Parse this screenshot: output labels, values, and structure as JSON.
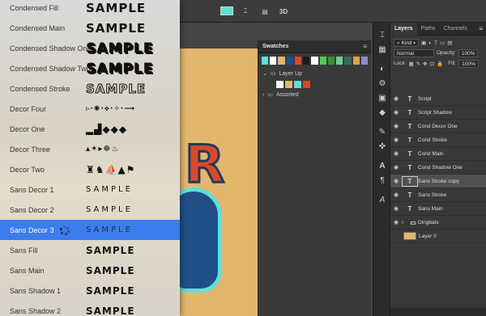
{
  "topbar": {
    "three_d_label": "3D",
    "text_icon_glyph": "⌶",
    "swatch_color": "#5fe0d6"
  },
  "swatches_panel": {
    "title": "Swatches",
    "menu_glyph": "≡",
    "collapse_glyph": "»",
    "recent_colors": [
      "#5fe0d6",
      "#ffffff",
      "#e3b66e",
      "#1f4f86",
      "#d94a2c",
      "#1a1a1a",
      "#ffffff",
      "#55c85a",
      "#3a8a3a",
      "#6fd08c",
      "#3a6a5a",
      "#d4a84a",
      "#8d8dc8"
    ],
    "folders": [
      {
        "label": "Layer Up",
        "expanded": true,
        "colors": [
          "#ffffff",
          "#e3b66e",
          "#5fe0d6",
          "#d94a2c"
        ]
      },
      {
        "label": "Assorted",
        "expanded": false,
        "colors": []
      }
    ]
  },
  "layers_panel": {
    "tabs": [
      "Layers",
      "Paths",
      "Channels"
    ],
    "active_tab": "Layers",
    "filter_label": "Kind",
    "blend_mode": "Normal",
    "opacity_label": "Opacity:",
    "opacity_value": "100%",
    "lock_label": "Lock:",
    "fill_label": "Fill:",
    "fill_value": "100%",
    "layers": [
      {
        "name": "Script",
        "kind": "text",
        "selected": false
      },
      {
        "name": "Script Shadow",
        "kind": "text",
        "selected": false
      },
      {
        "name": "Cond Decor One",
        "kind": "text",
        "selected": false
      },
      {
        "name": "Cond Stroke",
        "kind": "text",
        "selected": false
      },
      {
        "name": "Cond Main",
        "kind": "text",
        "selected": false
      },
      {
        "name": "Cond Shadow One",
        "kind": "text",
        "selected": false
      },
      {
        "name": "Sans Stroke copy",
        "kind": "text",
        "selected": true
      },
      {
        "name": "Sans Stroke",
        "kind": "text",
        "selected": false
      },
      {
        "name": "Sans Main",
        "kind": "text",
        "selected": false
      },
      {
        "name": "Dingbats",
        "kind": "group",
        "selected": false
      },
      {
        "name": "Layer 0",
        "kind": "fill",
        "selected": false
      }
    ]
  },
  "font_menu": {
    "sample_text": "SAMPLE",
    "items": [
      {
        "name": "Condensed Fill",
        "sample": "SAMPLE",
        "selected": false
      },
      {
        "name": "Condensed Main",
        "sample": "SAMPLE",
        "selected": false
      },
      {
        "name": "Condensed Shadow One",
        "sample": "SAMPLE",
        "selected": false
      },
      {
        "name": "Condensed Shadow Two",
        "sample": "SAMPLE",
        "selected": false
      },
      {
        "name": "Condensed Stroke",
        "sample": "SAMPLE",
        "selected": false
      },
      {
        "name": "Decor Four",
        "sample": "▹·✺·⟡·✧·⟶",
        "selected": false
      },
      {
        "name": "Decor One",
        "sample": "▂▟◆◆◆",
        "selected": false
      },
      {
        "name": "Decor Three",
        "sample": "▴✶▸☸♨",
        "selected": false
      },
      {
        "name": "Decor Two",
        "sample": "♜♞⛵▲⚑",
        "selected": false
      },
      {
        "name": "Sans Decor 1",
        "sample": "SAMPLE",
        "selected": false
      },
      {
        "name": "Sans Decor 2",
        "sample": "SAMPLE",
        "selected": false
      },
      {
        "name": "Sans Decor 3",
        "sample": "SAMPLE",
        "selected": true
      },
      {
        "name": "Sans Fill",
        "sample": "SAMPLE",
        "selected": false
      },
      {
        "name": "Sans Main",
        "sample": "SAMPLE",
        "selected": false
      },
      {
        "name": "Sans Shadow 1",
        "sample": "SAMPLE",
        "selected": false
      },
      {
        "name": "Sans Shadow 2",
        "sample": "SAMPLE",
        "selected": false
      }
    ]
  },
  "canvas": {
    "background_color": "#e3b66e",
    "visible_letter": "R"
  }
}
